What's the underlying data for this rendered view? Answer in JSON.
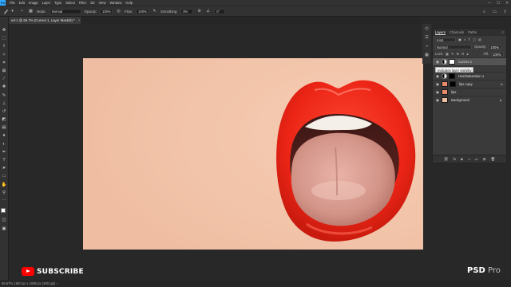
{
  "menubar": {
    "app_icon": "Ps",
    "items": [
      "File",
      "Edit",
      "Image",
      "Layer",
      "Type",
      "Select",
      "Filter",
      "3D",
      "View",
      "Window",
      "Help"
    ],
    "window_buttons": [
      "—",
      "☐",
      "✕"
    ]
  },
  "options_bar": {
    "mode_label": "Mode:",
    "mode_value": "Normal",
    "opacity_label": "Opacity:",
    "opacity_value": "100%",
    "flow_label": "Flow:",
    "flow_value": "100%",
    "smoothing_label": "Smoothing:",
    "smoothing_value": "0%",
    "angle_value": "0°"
  },
  "document": {
    "tab_title": "ed-1 @ 66.7% (Curves 1, Layer Mask/8) *",
    "close": "×"
  },
  "toolbar": {
    "tools": [
      "move-icon",
      "marquee-icon",
      "lasso-icon",
      "quick-select-icon",
      "crop-icon",
      "frame-icon",
      "eyedropper-icon",
      "healing-icon",
      "brush-icon",
      "stamp-icon",
      "history-brush-icon",
      "eraser-icon",
      "gradient-icon",
      "blur-icon",
      "dodge-icon",
      "pen-icon",
      "type-icon",
      "path-select-icon",
      "rectangle-icon",
      "hand-icon",
      "zoom-icon"
    ],
    "foreground_color": "#ffffff",
    "background_color": "#000000"
  },
  "layers_panel": {
    "tabs": [
      "Layers",
      "Channels",
      "Paths"
    ],
    "menu_icon": "≡",
    "kind_label": "Kind",
    "blend_mode": "Normal",
    "opacity_label": "Opacity:",
    "opacity_value": "100%",
    "lock_label": "Lock:",
    "fill_label": "Fill:",
    "fill_value": "100%",
    "tooltip": "Indicates layer visibility",
    "layers": [
      {
        "name": "Curves 1",
        "type": "adjustment",
        "selected": true
      },
      {
        "name": "Hue/Saturation 1",
        "type": "adjustment",
        "selected": false
      },
      {
        "name": "lips copy",
        "type": "pixel",
        "selected": false
      },
      {
        "name": "lips",
        "type": "pixel",
        "selected": false
      },
      {
        "name": "Background",
        "type": "background",
        "selected": false
      }
    ],
    "footer_icons": [
      "link-icon",
      "fx-icon",
      "mask-icon",
      "adjustment-icon",
      "group-icon",
      "new-layer-icon",
      "trash-icon"
    ]
  },
  "status_bar": {
    "text": "66.67%   1920 px x 1080 px (300 ppi)   ›"
  },
  "overlay": {
    "subscribe": "SUBSCRIBE",
    "brand_psd": "PSD",
    "brand_pro": "Pro"
  },
  "colors": {
    "skin": "#f2c3a7",
    "lips": "#f02a1c",
    "tongue": "#d8a096",
    "youtube_red": "#ff0000",
    "photoshop_blue": "#31a8ff"
  }
}
